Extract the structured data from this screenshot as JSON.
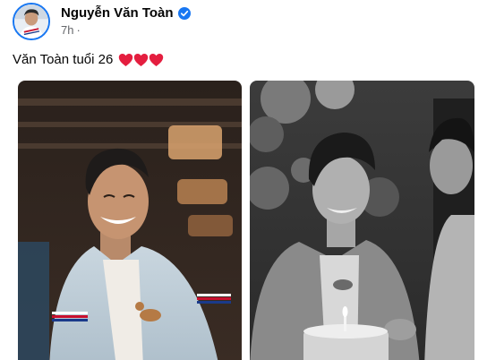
{
  "post": {
    "author": "Nguyễn Văn Toàn",
    "time": "7h",
    "meta_separator": "·",
    "caption": "Văn Toàn tuổi 26",
    "hearts": [
      "red-heart",
      "red-heart",
      "red-heart"
    ]
  },
  "colors": {
    "accent": "#1877f2",
    "heart": "#e41e3f",
    "secondary_text": "#65676b"
  },
  "photos": [
    {
      "name": "photo-left",
      "style": "color"
    },
    {
      "name": "photo-right",
      "style": "black-and-white"
    }
  ]
}
